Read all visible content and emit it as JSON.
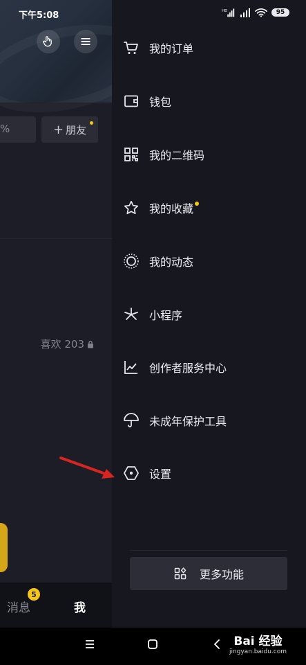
{
  "status_bar": {
    "time": "下午5:08",
    "battery": "95"
  },
  "left_page": {
    "partial_field": "%",
    "add_friend_label": "朋友",
    "likes_label": "喜欢 203",
    "nav": {
      "messages_label": "消息",
      "messages_badge": "5",
      "me_label": "我"
    }
  },
  "drawer": {
    "items": [
      {
        "label": "我的订单",
        "icon": "cart-icon"
      },
      {
        "label": "钱包",
        "icon": "wallet-icon"
      },
      {
        "label": "我的二维码",
        "icon": "qr-code-icon"
      },
      {
        "label": "我的收藏",
        "icon": "star-icon",
        "has_dot": true
      },
      {
        "label": "我的动态",
        "icon": "dotted-circle-icon"
      },
      {
        "label": "小程序",
        "icon": "mini-program-icon"
      },
      {
        "label": "创作者服务中心",
        "icon": "chart-line-icon"
      },
      {
        "label": "未成年保护工具",
        "icon": "umbrella-icon"
      },
      {
        "label": "设置",
        "icon": "hexagon-settings-icon"
      }
    ],
    "more_button_label": "更多功能"
  },
  "watermark": {
    "logo": "Bai 经验",
    "url": "jingyan.baidu.com"
  },
  "colors": {
    "accent_yellow": "#f5c518",
    "drawer_bg": "#17181f",
    "arrow_red": "#d7261f"
  }
}
